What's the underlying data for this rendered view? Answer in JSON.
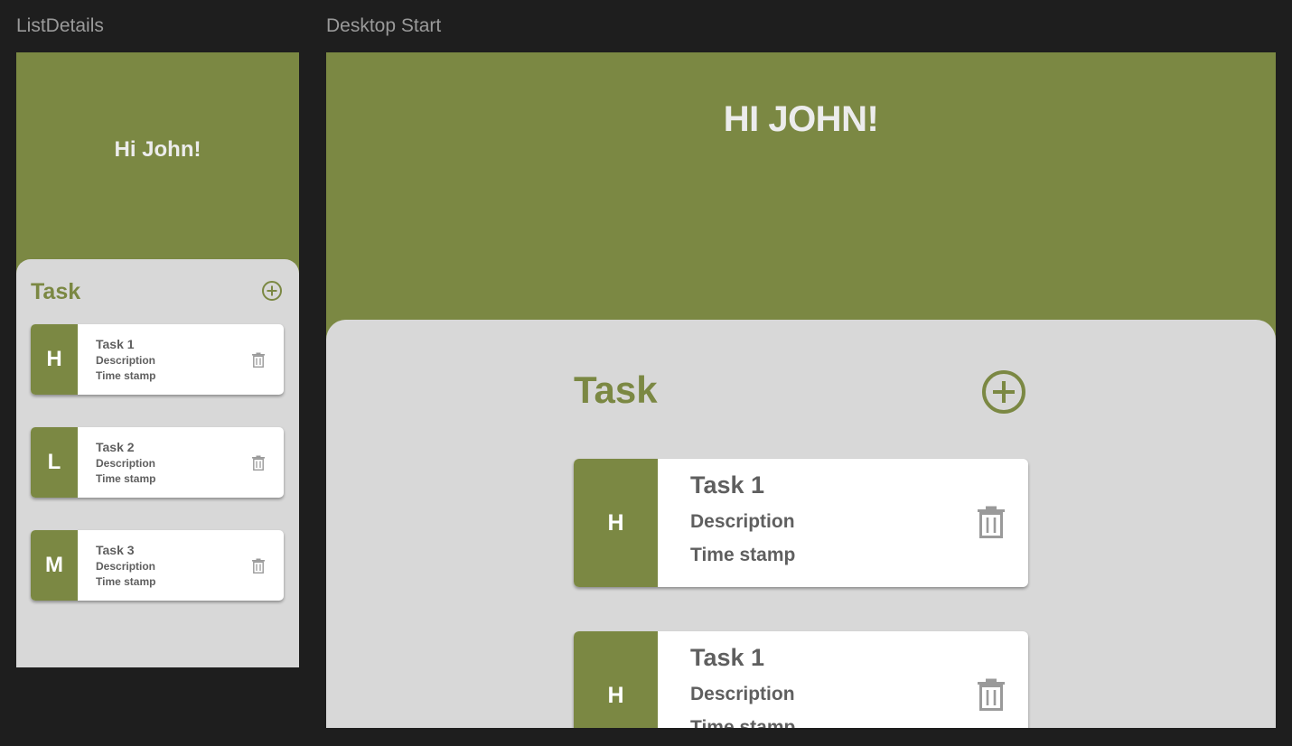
{
  "frames": {
    "mobile_label": "ListDetails",
    "desktop_label": "Desktop Start"
  },
  "colors": {
    "accent": "#7b8843",
    "sheet": "#d8d8d8",
    "canvas": "#1e1e1e",
    "card": "#ffffff",
    "text": "#5f5f5f"
  },
  "mobile": {
    "greeting": "Hi John!",
    "task_title": "Task",
    "add_icon": "add-circle-icon",
    "tasks": [
      {
        "badge": "H",
        "title": "Task 1",
        "description": "Description",
        "timestamp": "Time stamp",
        "icon": "trash-icon"
      },
      {
        "badge": "L",
        "title": "Task 2",
        "description": "Description",
        "timestamp": "Time stamp",
        "icon": "trash-icon"
      },
      {
        "badge": "M",
        "title": "Task 3",
        "description": "Description",
        "timestamp": "Time stamp",
        "icon": "trash-icon"
      }
    ]
  },
  "desktop": {
    "greeting": "HI JOHN!",
    "task_title": "Task",
    "add_icon": "add-circle-icon",
    "tasks": [
      {
        "badge": "H",
        "title": "Task 1",
        "description": "Description",
        "timestamp": "Time stamp",
        "icon": "trash-icon"
      },
      {
        "badge": "H",
        "title": "Task 1",
        "description": "Description",
        "timestamp": "Time stamp",
        "icon": "trash-icon"
      }
    ]
  }
}
